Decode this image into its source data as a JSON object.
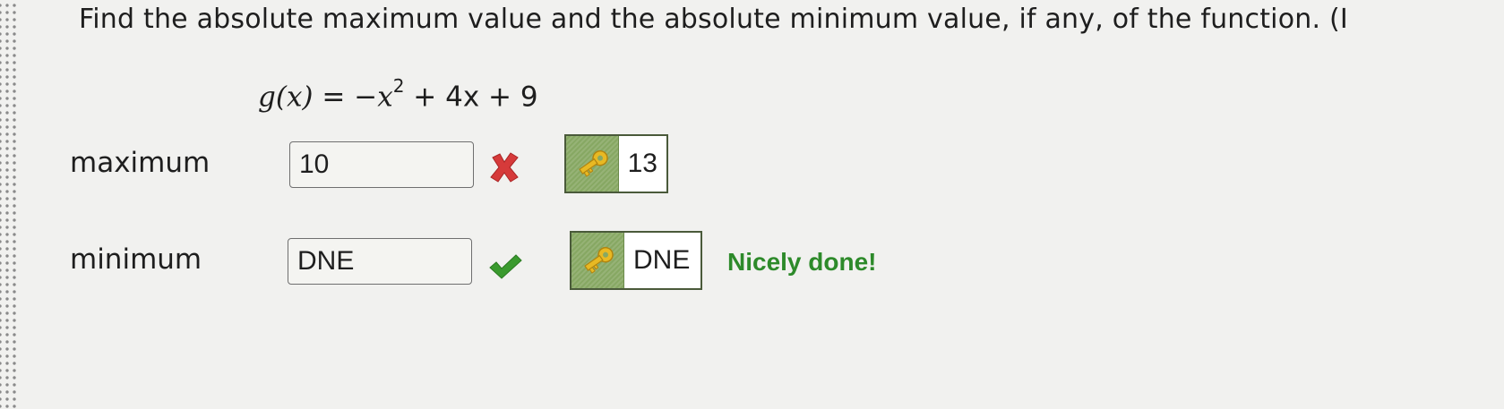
{
  "question": {
    "text": "Find the absolute maximum value and the absolute minimum value, if any, of the function. (I"
  },
  "equation": {
    "lhs": "g(x)",
    "equals": "=",
    "term1": "−x",
    "exponent": "2",
    "rest": "+ 4x + 9"
  },
  "maximum": {
    "label": "maximum",
    "input_value": "10",
    "result_icon": "red-x-icon",
    "answer_key_icon": "key-icon",
    "answer_value": "13"
  },
  "minimum": {
    "label": "minimum",
    "input_value": "DNE",
    "result_icon": "green-check-icon",
    "answer_key_icon": "key-icon",
    "answer_value": "DNE",
    "feedback": "Nicely done!"
  },
  "colors": {
    "incorrect": "#d63a3a",
    "correct": "#3a9a2e",
    "key_bg": "#87a863",
    "feedback": "#2d8a2a"
  }
}
